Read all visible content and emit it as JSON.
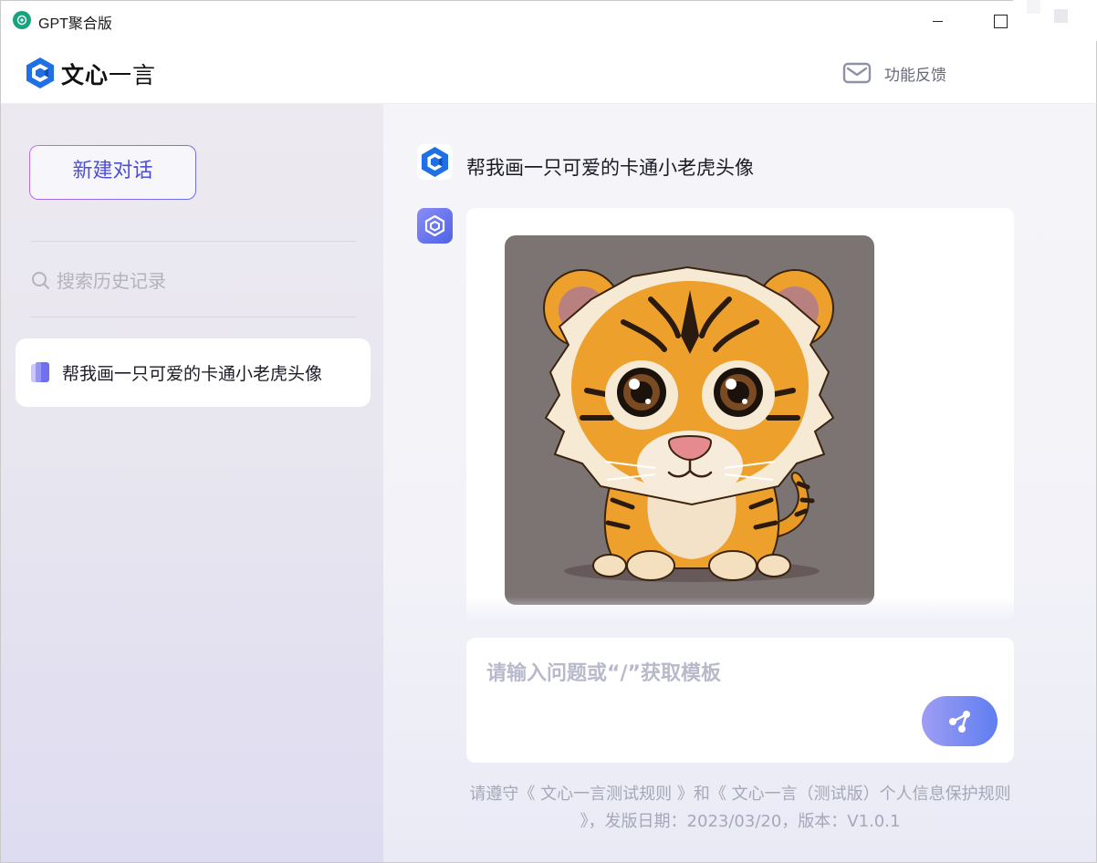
{
  "window": {
    "title": "GPT聚合版"
  },
  "header": {
    "logo_bold": "文心",
    "logo_light": "一言",
    "feedback_label": "功能反馈"
  },
  "sidebar": {
    "new_chat_label": "新建对话",
    "search_placeholder": "搜索历史记录",
    "history": [
      {
        "label": "帮我画一只可爱的卡通小老虎头像"
      }
    ]
  },
  "chat": {
    "messages": [
      {
        "role": "user",
        "text": "帮我画一只可爱的卡通小老虎头像"
      },
      {
        "role": "assistant",
        "content": "cartoon tiger image"
      }
    ]
  },
  "composer": {
    "placeholder": "请输入问题或“/”获取模板"
  },
  "footer": {
    "note": "请遵守《 文心一言测试规则 》和《 文心一言（测试版）个人信息保护规则 》，发版日期：2023/03/20，版本：V1.0.1"
  },
  "colors": {
    "brand_blue": "#1f6fe5",
    "accent_purple": "#4d4fd8",
    "send_gradient_start": "#9f9df4",
    "send_gradient_end": "#5e7ef0"
  }
}
